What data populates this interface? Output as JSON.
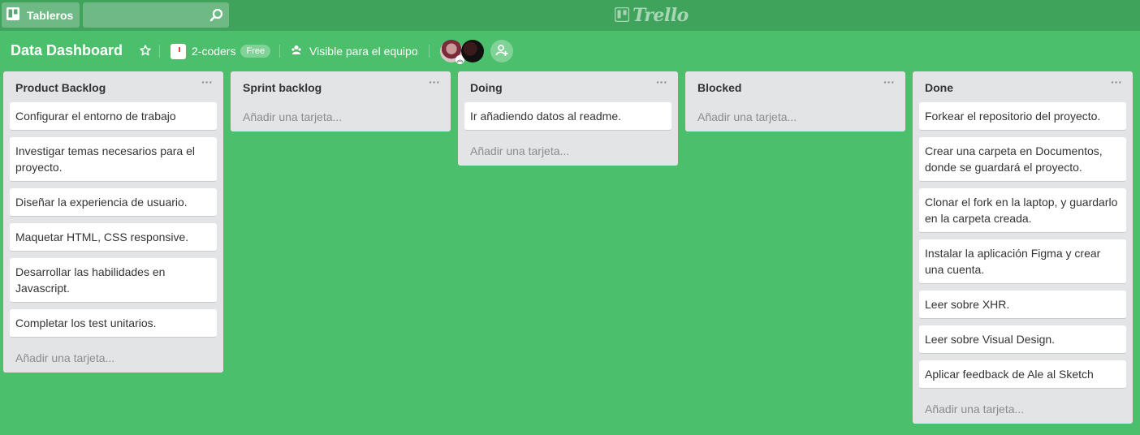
{
  "topbar": {
    "boards_label": "Tableros",
    "search_value": "",
    "logo_text": "Trello"
  },
  "board": {
    "title": "Data Dashboard",
    "team_name": "2-coders",
    "team_badge": "Free",
    "visibility": "Visible para el equipo"
  },
  "lists": [
    {
      "title": "Product Backlog",
      "cards": [
        "Configurar el entorno de trabajo",
        "Investigar temas necesarios para el proyecto.",
        "Diseñar la experiencia de usuario.",
        "Maquetar HTML, CSS responsive.",
        "Desarrollar las habilidades en Javascript.",
        "Completar los test unitarios."
      ],
      "add_label": "Añadir una tarjeta..."
    },
    {
      "title": "Sprint backlog",
      "cards": [],
      "add_label": "Añadir una tarjeta..."
    },
    {
      "title": "Doing",
      "cards": [
        "Ir añadiendo datos al readme."
      ],
      "add_label": "Añadir una tarjeta..."
    },
    {
      "title": "Blocked",
      "cards": [],
      "add_label": "Añadir una tarjeta..."
    },
    {
      "title": "Done",
      "cards": [
        "Forkear el repositorio del proyecto.",
        "Crear una carpeta en Documentos, donde se guardará el proyecto.",
        "Clonar el fork en la laptop, y guardarlo en la carpeta creada.",
        "Instalar la aplicación Figma y crear una cuenta.",
        "Leer sobre XHR.",
        "Leer sobre Visual Design.",
        "Aplicar feedback de Ale al Sketch"
      ],
      "add_label": "Añadir una tarjeta..."
    }
  ],
  "menu_glyph": "···",
  "colors": {
    "board_bg": "#4bbf6b",
    "topbar_bg": "#3fa35b",
    "list_bg": "#e2e4e6"
  }
}
